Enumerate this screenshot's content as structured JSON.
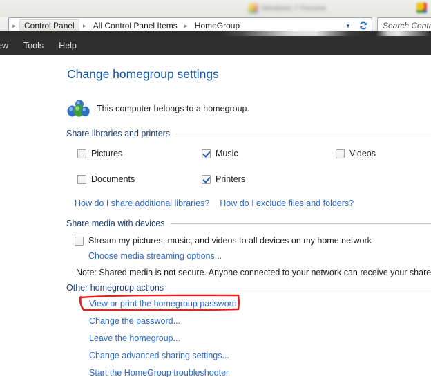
{
  "browser": {
    "tab_title": "Windows 7 Forums",
    "favicon_icon": "multicolor-favicon-icon"
  },
  "explorer": {
    "breadcrumb": {
      "name": "breadcrumb",
      "items": [
        "Control Panel",
        "All Control Panel Items",
        "HomeGroup"
      ],
      "separator_icon": "chevron-right-icon",
      "dropdown_icon": "chevron-down-icon",
      "refresh_icon": "refresh-icon"
    },
    "search": {
      "placeholder": "Search Contr",
      "icon": "search-icon"
    },
    "menubar": [
      "ew",
      "Tools",
      "Help"
    ]
  },
  "page": {
    "title": "Change homegroup settings",
    "status": {
      "icon": "homegroup-icon",
      "text": "This computer belongs to a homegroup."
    },
    "sections": {
      "libraries": {
        "heading": "Share libraries and printers",
        "checkboxes": [
          {
            "label": "Pictures",
            "checked": false
          },
          {
            "label": "Music",
            "checked": true
          },
          {
            "label": "Videos",
            "checked": false
          },
          {
            "label": "Documents",
            "checked": false
          },
          {
            "label": "Printers",
            "checked": true
          }
        ],
        "links": [
          "How do I share additional libraries?",
          "How do I exclude files and folders?"
        ]
      },
      "media": {
        "heading": "Share media with devices",
        "stream_checkbox": {
          "label": "Stream my pictures, music, and videos to all devices on my home network",
          "checked": false
        },
        "link": "Choose media streaming options...",
        "note": "Note: Shared media is not secure. Anyone connected to your network can receive your shared me"
      },
      "other": {
        "heading": "Other homegroup actions",
        "links": [
          "View or print the homegroup password",
          "Change the password...",
          "Leave the homegroup...",
          "Change advanced sharing settings...",
          "Start the HomeGroup troubleshooter"
        ]
      }
    }
  },
  "annotation": {
    "shape": "red-rectangle-highlight",
    "color": "#ee1c1c",
    "targets": "View or print the homegroup password"
  },
  "colors": {
    "title_blue": "#11559e",
    "link_blue": "#2a68c8",
    "section_heading": "#1d3d6e",
    "annotation_red": "#ee1c1c",
    "menubar_bg": "#2f2f2f"
  }
}
